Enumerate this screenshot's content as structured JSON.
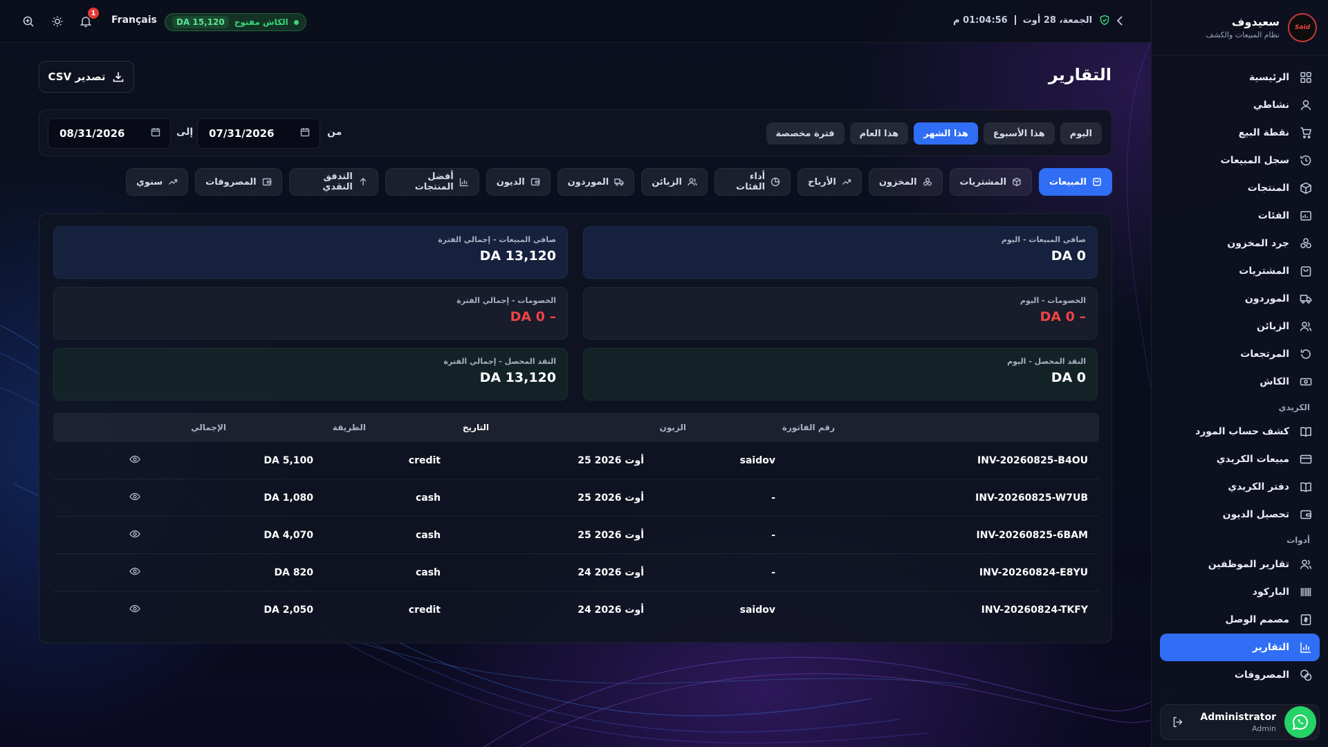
{
  "brand": {
    "title": "سعيدوف",
    "subtitle": "نظام المبيعات والكشف",
    "logo_text": "Said"
  },
  "topbar": {
    "language": "Français",
    "cash_status": "الكاش مفتوح",
    "cash_amount": "DA 15,120",
    "notification_count": "1",
    "date": "الجمعة، 28 أوت",
    "time": "01:04:56 م"
  },
  "sidebar": {
    "items": [
      {
        "label": "الرئيسية",
        "icon": "grid-icon"
      },
      {
        "label": "نشاطي",
        "icon": "user-icon"
      },
      {
        "label": "نقطة البيع",
        "icon": "cart-icon"
      },
      {
        "label": "سجل المبيعات",
        "icon": "history-icon"
      },
      {
        "label": "المنتجات",
        "icon": "box-icon"
      },
      {
        "label": "الفئات",
        "icon": "category-icon"
      },
      {
        "label": "جرد المخزون",
        "icon": "stack-icon"
      },
      {
        "label": "المشتريات",
        "icon": "bag-icon"
      },
      {
        "label": "الموردون",
        "icon": "truck-icon"
      },
      {
        "label": "الزبائن",
        "icon": "users-icon"
      },
      {
        "label": "المرتجعات",
        "icon": "return-icon"
      },
      {
        "label": "الكاش",
        "icon": "cash-icon"
      }
    ],
    "section_credit": "الكريدي",
    "credit_items": [
      {
        "label": "كشف حساب المورد",
        "icon": "book-icon"
      },
      {
        "label": "مبيعات الكريدي",
        "icon": "card-icon"
      },
      {
        "label": "دفتر الكريدي",
        "icon": "book-icon"
      },
      {
        "label": "تحصيل الديون",
        "icon": "wallet-icon"
      }
    ],
    "section_tools": "أدوات",
    "tool_items": [
      {
        "label": "تقارير الموظفين",
        "icon": "users-icon"
      },
      {
        "label": "الباركود",
        "icon": "barcode-icon"
      },
      {
        "label": "مصمم الوصل",
        "icon": "receipt-icon"
      },
      {
        "label": "التقارير",
        "icon": "chart-icon"
      },
      {
        "label": "المصروفات",
        "icon": "coins-icon"
      }
    ],
    "user": {
      "name": "Administrator",
      "role": "Admin"
    }
  },
  "page": {
    "title": "التقارير",
    "export_label": "تصدير CSV",
    "periods": [
      "اليوم",
      "هذا الأسبوع",
      "هذا الشهر",
      "هذا العام",
      "فترة مخصصة"
    ],
    "active_period": "هذا الشهر",
    "from_label": "من",
    "to_label": "إلى",
    "from_date": "07/31/2026",
    "to_date": "08/31/2026",
    "tabs": [
      {
        "label": "المبيعات",
        "icon": "bag-icon"
      },
      {
        "label": "المشتريات",
        "icon": "box-icon"
      },
      {
        "label": "المخزون",
        "icon": "stack-icon"
      },
      {
        "label": "الأرباح",
        "icon": "trend-icon"
      },
      {
        "label": "أداء الفئات",
        "icon": "pie-icon"
      },
      {
        "label": "الزبائن",
        "icon": "users-icon"
      },
      {
        "label": "الموردون",
        "icon": "truck-icon"
      },
      {
        "label": "الديون",
        "icon": "wallet-icon"
      },
      {
        "label": "أفضل المنتجات",
        "icon": "bar-icon"
      },
      {
        "label": "التدفق النقدي",
        "icon": "arrow-up-icon"
      },
      {
        "label": "المصروفات",
        "icon": "wallet-icon"
      },
      {
        "label": "سنوي",
        "icon": "trend-icon"
      }
    ],
    "stats": {
      "net_sales_today_label": "صافي المبيعات - اليوم",
      "net_sales_today_value": "DA 0",
      "net_sales_period_label": "صافي المبيعات - إجمالي الفترة",
      "net_sales_period_value": "DA 13,120",
      "discounts_today_label": "الخصومات - اليوم",
      "discounts_today_value": "DA 0 –",
      "discounts_period_label": "الخصومات - إجمالي الفترة",
      "discounts_period_value": "DA 0 –",
      "cash_today_label": "النقد المحصل - اليوم",
      "cash_today_value": "DA 0",
      "cash_period_label": "النقد المحصل - إجمالي الفترة",
      "cash_period_value": "DA 13,120"
    },
    "table": {
      "headers": {
        "invoice": "رقم الفاتورة",
        "customer": "الزبون",
        "date": "التاريخ",
        "method": "الطريقة",
        "total": "الإجمالي"
      },
      "rows": [
        {
          "invoice": "INV-20260825-B4OU",
          "customer": "saidov",
          "date": "25 أوت 2026",
          "method": "credit",
          "total": "DA 5,100"
        },
        {
          "invoice": "INV-20260825-W7UB",
          "customer": "-",
          "date": "25 أوت 2026",
          "method": "cash",
          "total": "DA 1,080"
        },
        {
          "invoice": "INV-20260825-6BAM",
          "customer": "-",
          "date": "25 أوت 2026",
          "method": "cash",
          "total": "DA 4,070"
        },
        {
          "invoice": "INV-20260824-E8YU",
          "customer": "-",
          "date": "24 أوت 2026",
          "method": "cash",
          "total": "DA 820"
        },
        {
          "invoice": "INV-20260824-TKFY",
          "customer": "saidov",
          "date": "24 أوت 2026",
          "method": "credit",
          "total": "DA 2,050"
        }
      ]
    }
  },
  "colors": {
    "accent": "#2f6ef5",
    "danger": "#ef4444",
    "success": "#37d67a"
  }
}
